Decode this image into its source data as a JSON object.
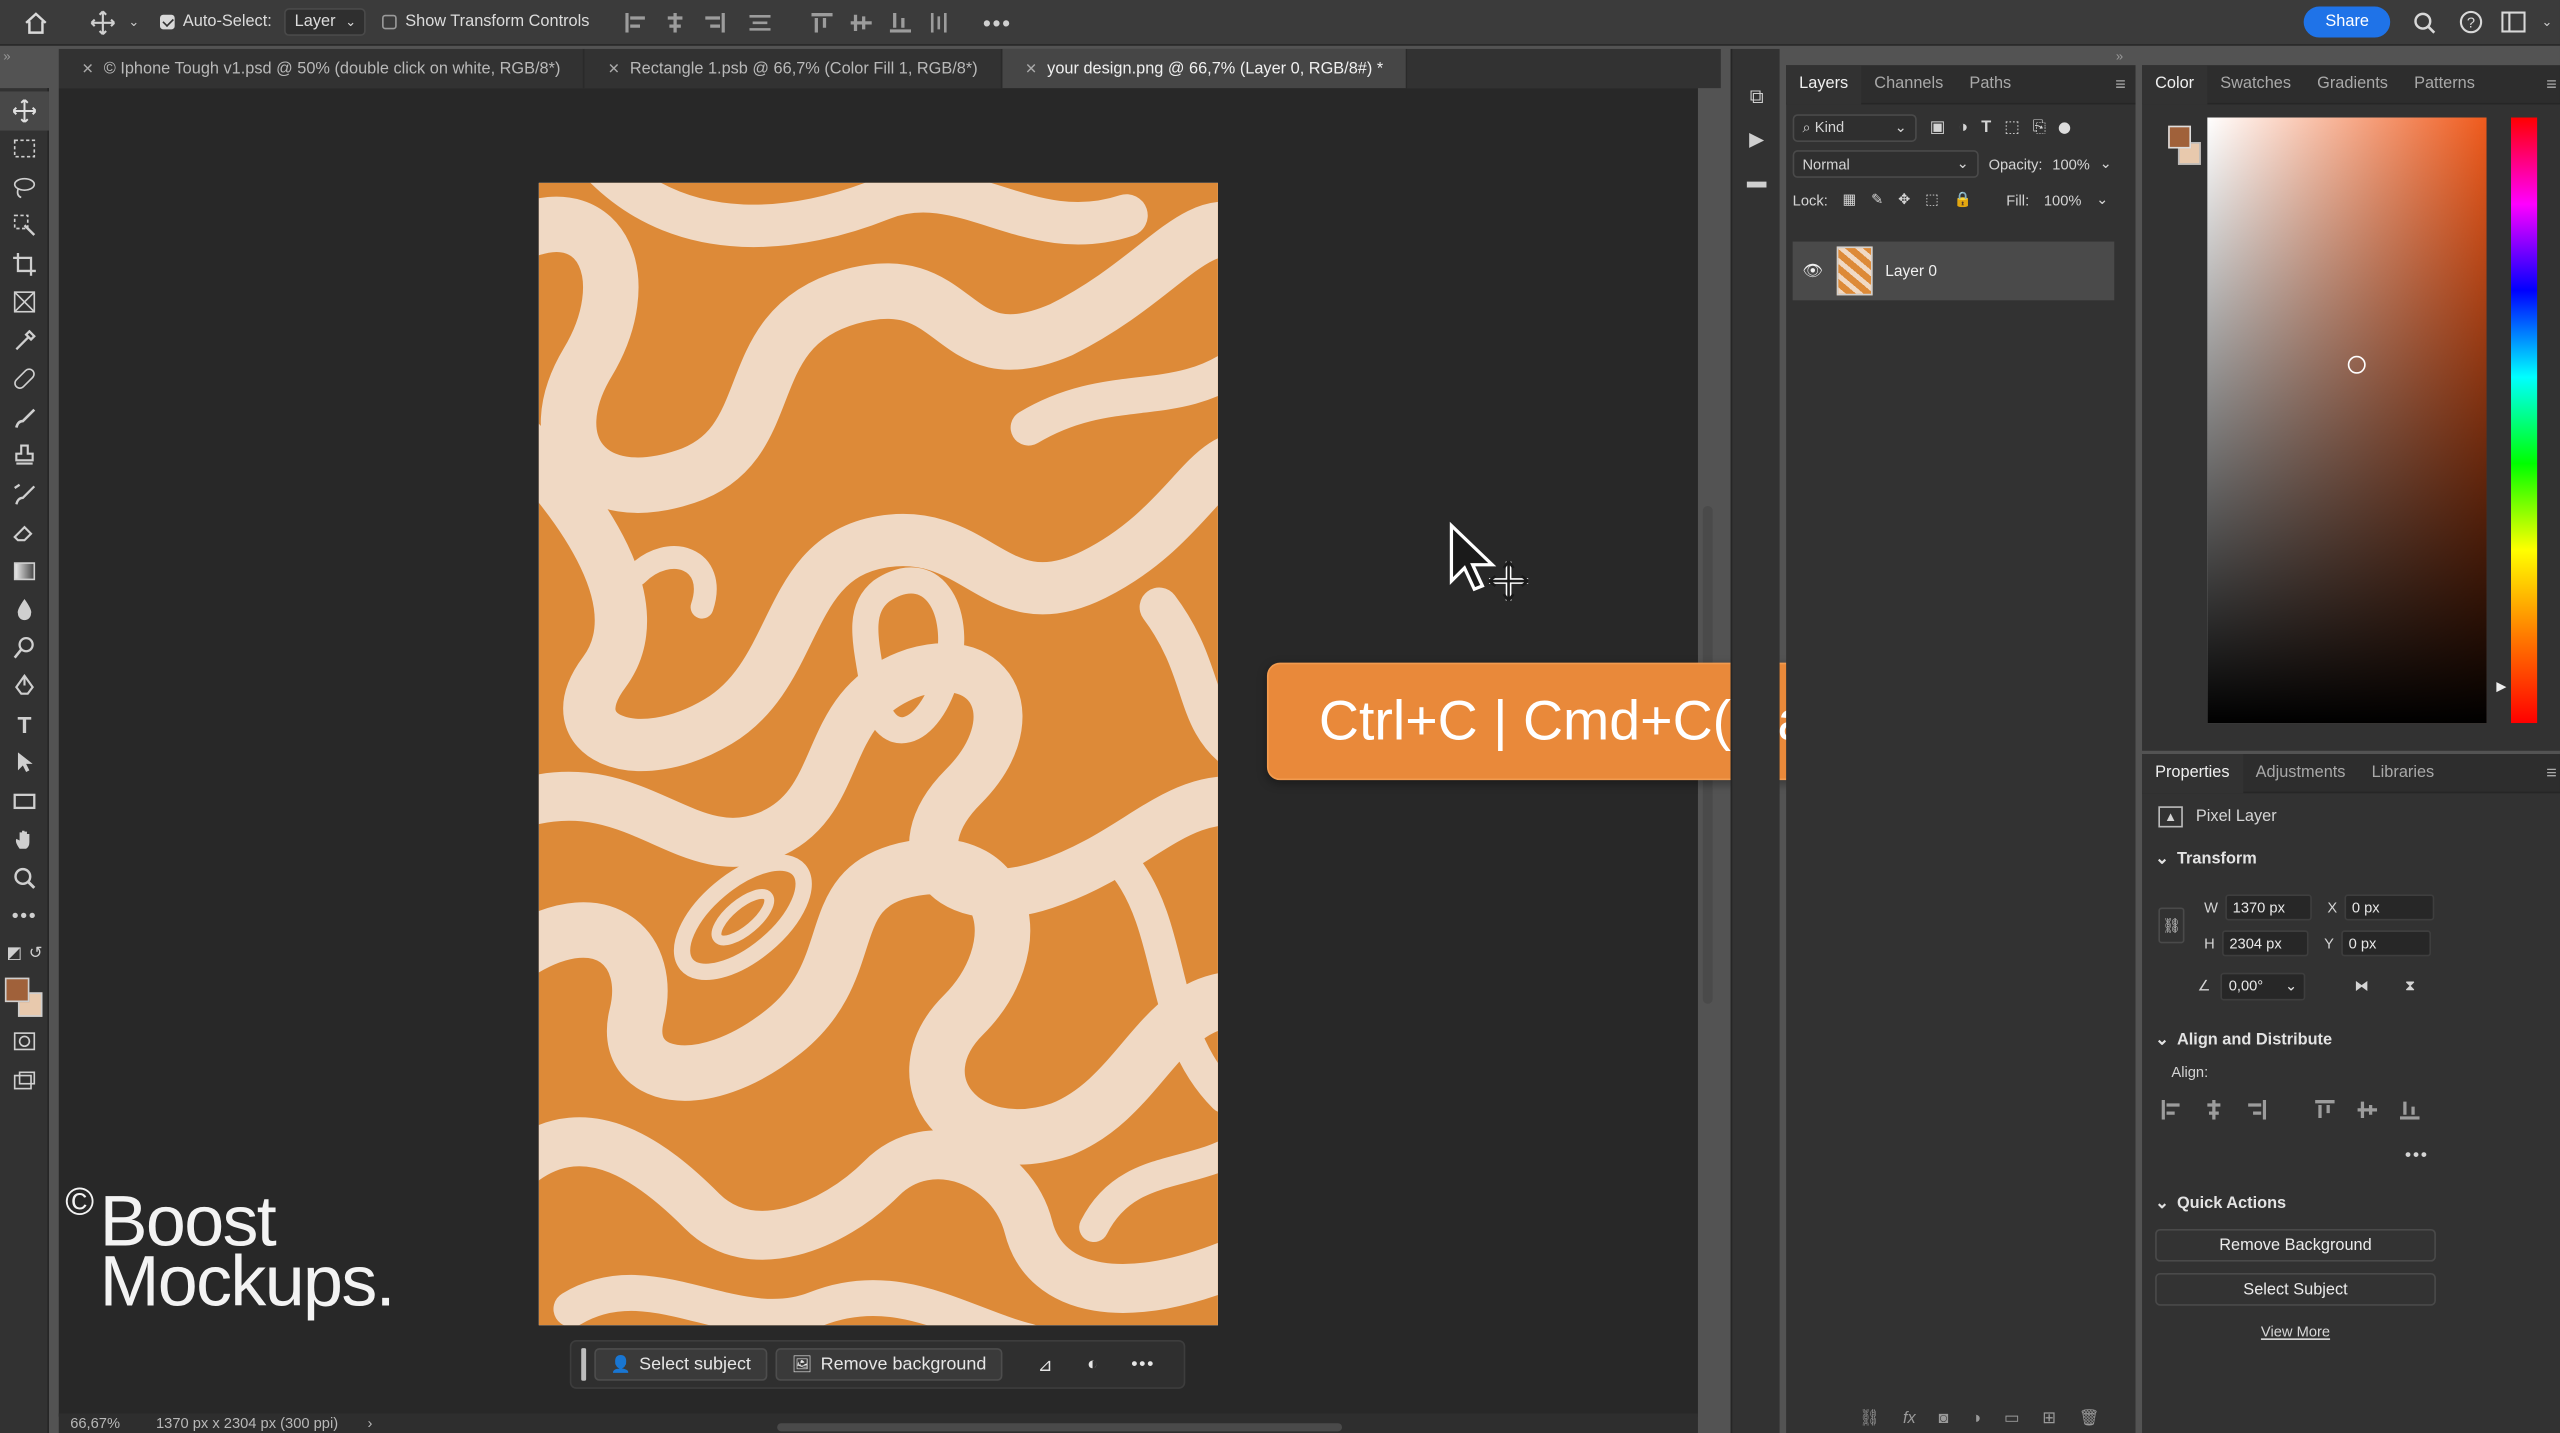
{
  "options_bar": {
    "auto_select_label": "Auto-Select:",
    "auto_select_mode": "Layer",
    "transform_controls_label": "Show Transform Controls",
    "share_label": "Share"
  },
  "tabs": [
    {
      "label": "© Iphone Tough v1.psd @ 50% (double click on white, RGB/8*)"
    },
    {
      "label": "Rectangle 1.psb @ 66,7% (Color Fill 1, RGB/8*)"
    },
    {
      "label": "your design.png @ 66,7% (Layer 0, RGB/8#) *"
    }
  ],
  "layers_panel": {
    "tabs": [
      "Layers",
      "Channels",
      "Paths"
    ],
    "kind_label": "Kind",
    "blend_mode": "Normal",
    "opacity_label": "Opacity:",
    "opacity_value": "100%",
    "lock_label": "Lock:",
    "fill_label": "Fill:",
    "fill_value": "100%",
    "layer_name": "Layer 0"
  },
  "color_panel": {
    "tabs": [
      "Color",
      "Swatches",
      "Gradients",
      "Patterns"
    ],
    "foreground": "#a0613a",
    "background": "#e8c9ad"
  },
  "properties_panel": {
    "tabs": [
      "Properties",
      "Adjustments",
      "Libraries"
    ],
    "layer_type": "Pixel Layer",
    "transform_title": "Transform",
    "w_label": "W",
    "w_value": "1370 px",
    "h_label": "H",
    "h_value": "2304 px",
    "x_label": "X",
    "x_value": "0 px",
    "y_label": "Y",
    "y_value": "0 px",
    "angle_value": "0,00°",
    "align_title": "Align and Distribute",
    "align_label": "Align:",
    "quick_title": "Quick Actions",
    "remove_bg": "Remove Background",
    "select_subject": "Select Subject",
    "view_more": "View More"
  },
  "context_bar": {
    "select_subject": "Select subject",
    "remove_background": "Remove background"
  },
  "status": {
    "zoom": "66,67%",
    "doc_info": "1370 px x 2304 px (300 ppi)"
  },
  "callout_text": "Ctrl+C | Cmd+C(mac) copy",
  "watermark": {
    "line1": "Boost",
    "line2": "Mockups."
  },
  "colors": {
    "artwork_orange": "#dd8a38",
    "artwork_cream": "#f0d9c4",
    "accent_blue": "#1f73e8",
    "callout_orange": "#e9893a"
  }
}
